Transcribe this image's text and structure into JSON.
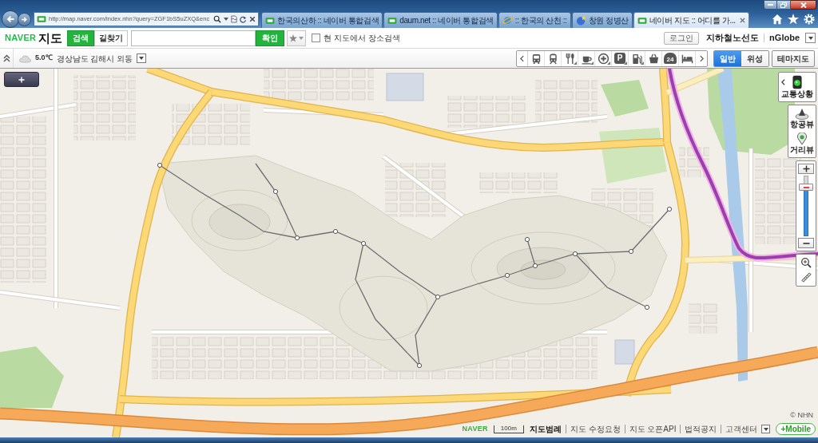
{
  "browser": {
    "url": "http://map.naver.com/index.nhn?query=ZGF1bS5uZXQ&enc",
    "tabs": [
      {
        "title": "한국의산하 :: 네이버 통합검색",
        "kind": "naver",
        "selected": false
      },
      {
        "title": "daum.net :: 네이버 통합검색",
        "kind": "naver",
        "selected": false
      },
      {
        "title": ":: 한국의 산천 ::",
        "kind": "ie",
        "selected": false
      },
      {
        "title": "창원 정병산",
        "kind": "globe",
        "selected": false
      },
      {
        "title": "네이버 지도 :: 어디를 가...",
        "kind": "naver",
        "selected": true
      }
    ]
  },
  "header": {
    "logo": {
      "brand": "NAVER",
      "product": "지도"
    },
    "modes": [
      {
        "label": "검색",
        "selected": true
      },
      {
        "label": "길찾기",
        "selected": false
      }
    ],
    "submit": "확인",
    "local_search": {
      "label": "현 지도에서 장소검색",
      "checked": false
    },
    "login": "로그인",
    "links": [
      "지하철노선도",
      "nGlobe"
    ]
  },
  "infobar": {
    "weather": {
      "temperature": "5.0℃",
      "location": "경상남도 김해시 외동"
    },
    "categories": [
      {
        "kind": "bus",
        "submenu": false
      },
      {
        "kind": "subway",
        "submenu": false
      },
      {
        "kind": "restaurant",
        "submenu": true
      },
      {
        "kind": "cafe",
        "submenu": true
      },
      {
        "kind": "hospital",
        "submenu": true
      },
      {
        "kind": "parking",
        "label": "P",
        "submenu": true
      },
      {
        "kind": "gas",
        "submenu": true
      },
      {
        "kind": "shopping",
        "submenu": false
      },
      {
        "kind": "convenience",
        "label": "24",
        "submenu": false
      },
      {
        "kind": "lodging",
        "submenu": false
      }
    ],
    "map_types": [
      {
        "label": "일반",
        "selected": true
      },
      {
        "label": "위성",
        "selected": false
      }
    ],
    "theme": "테마지도"
  },
  "map": {
    "traffic": {
      "label": "교통상황"
    },
    "views": [
      {
        "kind": "aerial",
        "label": "항공뷰"
      },
      {
        "kind": "street",
        "label": "거리뷰"
      }
    ],
    "zoom": {
      "level": 0.8
    },
    "copyright": "© NHN",
    "footer": {
      "logo": "NAVER",
      "scale": "100m",
      "links": [
        {
          "label": "지도범례",
          "strong": true
        },
        {
          "label": "지도 수정요청",
          "strong": false
        },
        {
          "label": "지도 오픈API",
          "strong": false
        },
        {
          "label": "법적공지",
          "strong": false
        },
        {
          "label": "고객센터",
          "strong": false
        }
      ],
      "mobile": "+Mobile"
    }
  }
}
